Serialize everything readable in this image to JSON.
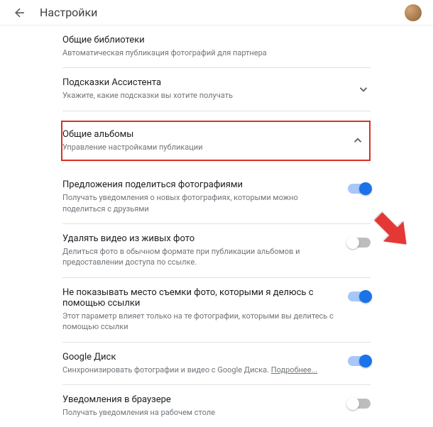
{
  "header": {
    "title": "Настройки"
  },
  "sections": {
    "shared_libs": {
      "title": "Общие библиотеки",
      "desc": "Автоматическая публикация фотографий для партнера"
    },
    "assistant": {
      "title": "Подсказки Ассистента",
      "desc": "Укажите, какие подсказки вы хотите получать"
    },
    "shared_albums": {
      "title": "Общие альбомы",
      "desc": "Управление настройками публикации"
    },
    "share_suggest": {
      "title": "Предложения поделиться фотографиями",
      "desc": "Получать уведомления о новых фотографиях, которыми можно поделиться с друзьями"
    },
    "live_video": {
      "title": "Удалять видео из живых фото",
      "desc": "Делиться фото в обычном формате при публикации альбомов и предоставлении доступа по ссылке."
    },
    "hide_location": {
      "title": "Не показывать место съемки фото, которыми я делюсь с помощью ссылки",
      "desc": "Этот параметр влияет только на те фотографии, которыми вы делитесь с помощью ссылки"
    },
    "drive": {
      "title": "Google Диск",
      "desc_prefix": "Синхронизировать фотографии и видео с Google Диска. ",
      "link": "Подробнее..."
    },
    "browser_notif": {
      "title": "Уведомления в браузере",
      "desc": "Получать уведомления на рабочем столе"
    }
  },
  "toggles": {
    "share_suggest": true,
    "live_video": false,
    "hide_location": true,
    "drive": true,
    "browser_notif": false
  }
}
